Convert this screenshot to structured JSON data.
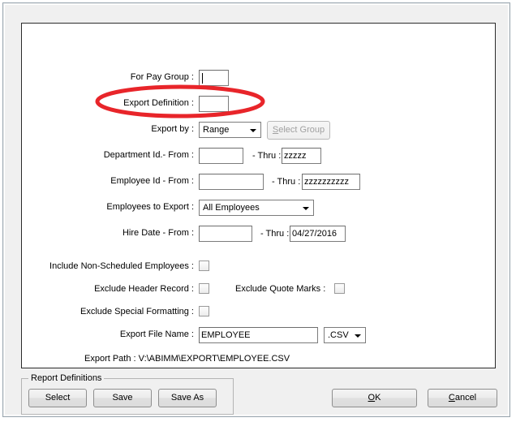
{
  "dialog": {
    "fields": {
      "pay_group": {
        "label": "For Pay Group :",
        "value": ""
      },
      "export_definition": {
        "label": "Export Definition :",
        "value": ""
      },
      "export_by": {
        "label": "Export by :",
        "value": "Range",
        "select_group_button": "Select Group"
      },
      "department_id": {
        "label": "Department Id.- From :",
        "from_value": "",
        "thru_label": "- Thru :",
        "thru_value": "zzzzz"
      },
      "employee_id": {
        "label": "Employee Id - From :",
        "from_value": "",
        "thru_label": "- Thru :",
        "thru_value": "zzzzzzzzzz"
      },
      "employees_to_export": {
        "label": "Employees to Export :",
        "value": "All Employees"
      },
      "hire_date": {
        "label": "Hire Date - From :",
        "from_value": "",
        "thru_label": "- Thru :",
        "thru_value": "04/27/2016"
      },
      "export_file_name": {
        "label": "Export File Name :",
        "value": "EMPLOYEE"
      },
      "export_extension": {
        "value": ".CSV"
      },
      "export_path": {
        "text": "Export Path :  V:\\ABIMM\\EXPORT\\EMPLOYEE.CSV"
      }
    },
    "checkboxes": {
      "include_non_scheduled": {
        "label": "Include Non-Scheduled Employees :",
        "checked": false
      },
      "exclude_header_record": {
        "label": "Exclude Header Record :",
        "checked": false
      },
      "exclude_quote_marks": {
        "label": "Exclude Quote Marks :",
        "checked": false
      },
      "exclude_special_formatting": {
        "label": "Exclude Special Formatting :",
        "checked": false
      }
    },
    "report_definitions": {
      "legend": "Report Definitions",
      "select_label": "Select",
      "save_label": "Save",
      "save_as_label": "Save As"
    },
    "actions": {
      "ok_prefix": "",
      "ok_accel": "O",
      "ok_suffix": "K",
      "cancel_accel": "C",
      "cancel_suffix": "ancel"
    },
    "annotation": {
      "shape": "ellipse",
      "color": "#e8252a",
      "target": "export_definition"
    }
  }
}
